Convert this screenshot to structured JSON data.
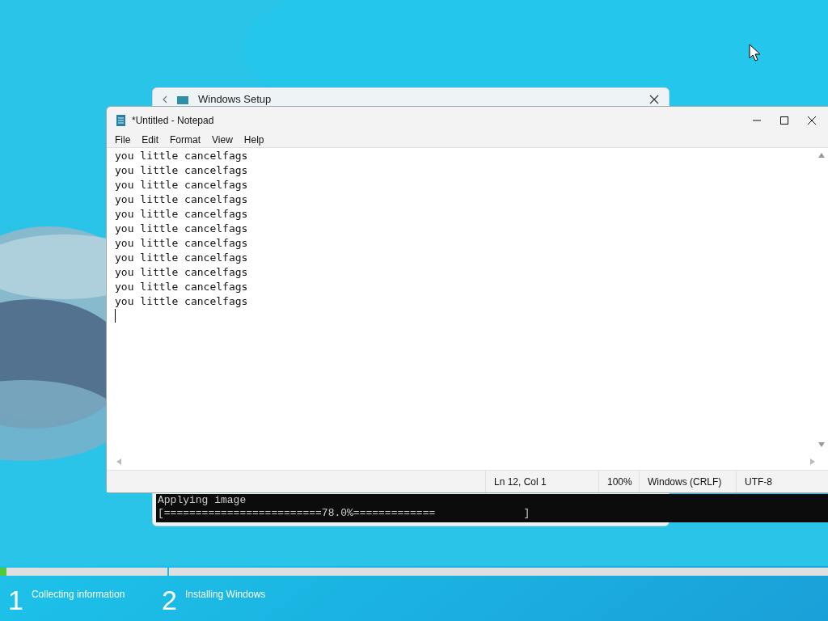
{
  "setup_window": {
    "title": "Windows Setup"
  },
  "notepad": {
    "title": "*Untitled - Notepad",
    "menu": [
      "File",
      "Edit",
      "Format",
      "View",
      "Help"
    ],
    "lines": [
      "you little cancelfags",
      "you little cancelfags",
      "you little cancelfags",
      "you little cancelfags",
      "you little cancelfags",
      "you little cancelfags",
      "you little cancelfags",
      "you little cancelfags",
      "you little cancelfags",
      "you little cancelfags",
      "you little cancelfags"
    ],
    "status_bar": [
      "Ln 12, Col 1",
      "100%",
      "Windows (CRLF)",
      "UTF-8"
    ]
  },
  "console": {
    "lines": [
      "Applying image",
      "[=========================78.0%=============              ]"
    ]
  },
  "progress": {
    "level": 0.04
  },
  "steps": [
    {
      "number": "1",
      "label": "Collecting information"
    },
    {
      "number": "2",
      "label": "Installing Windows"
    }
  ]
}
